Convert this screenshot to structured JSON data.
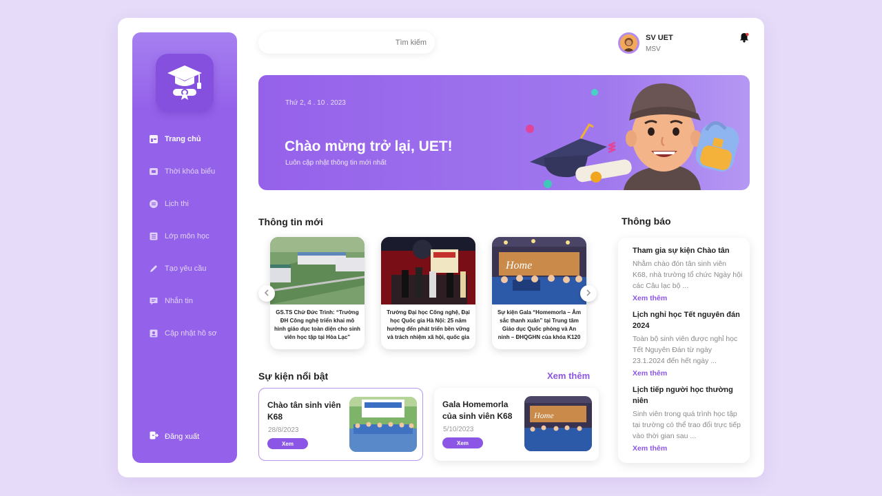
{
  "sidebar": {
    "logo_icon": "graduation-cap-icon",
    "items": [
      {
        "label": "Trang chủ",
        "icon": "home-icon",
        "active": true
      },
      {
        "label": "Thời khóa biểu",
        "icon": "schedule-icon"
      },
      {
        "label": "Lịch thi",
        "icon": "exam-icon"
      },
      {
        "label": "Lớp môn học",
        "icon": "class-icon"
      },
      {
        "label": "Tạo yêu cầu",
        "icon": "pen-icon"
      },
      {
        "label": "Nhắn tin",
        "icon": "chat-icon"
      },
      {
        "label": "Cập nhật hồ sơ",
        "icon": "profile-icon"
      }
    ],
    "logout_label": "Đăng xuất"
  },
  "header": {
    "search_placeholder": "Tìm kiếm",
    "user_name": "SV UET",
    "user_id": "MSV"
  },
  "banner": {
    "date": "Thứ 2, 4 . 10 . 2023",
    "title": "Chào mừng trở lại, UET!",
    "subtitle": "Luôn cập nhật thông tin mới nhất"
  },
  "news": {
    "title": "Thông tin mới",
    "items": [
      {
        "text": "GS.TS Chử Đức Trình: “Trường ĐH Công nghệ triển khai mô hình giáo dục toàn diện cho sinh viên học tập tại Hòa Lạc”"
      },
      {
        "text": "Trường Đại học Công nghệ, Đại học Quốc gia Hà Nội: 25 năm hướng đến phát triển bền vững và trách nhiệm xã hội, quốc gia"
      },
      {
        "text": "Sự kiện Gala “Homemorla – Âm sắc thanh xuân” tại Trung tâm Giáo dục Quốc phòng và An ninh – ĐHQGHN của khóa K120"
      }
    ]
  },
  "events": {
    "title": "Sự kiện nổi bật",
    "see_more": "Xem thêm",
    "items": [
      {
        "title": "Chào tân sinh viên K68",
        "date": "28/8/2023",
        "button": "Xem"
      },
      {
        "title": "Gala Homemorla của sinh viên K68",
        "date": "5/10/2023",
        "button": "Xem"
      }
    ]
  },
  "announcements": {
    "title": "Thông báo",
    "items": [
      {
        "title": "Tham gia sự kiện Chào tân",
        "desc": "Nhằm chào đón tân sinh viên K68, nhà trường tổ chức Ngày hội các Câu lạc bộ ...",
        "more": "Xem thêm"
      },
      {
        "title": "Lịch nghỉ học Tết nguyên đán 2024",
        "desc": "Toàn bộ sinh viên được nghỉ học Tết Nguyên Đán từ ngày 23.1.2024 đến hết ngày ...",
        "more": "Xem thêm"
      },
      {
        "title": "Lịch tiếp người học thường niên",
        "desc": "Sinh viên trong quá trình học tập tại trường có thể trao đổi trực tiếp vào thời gian sau ...",
        "more": "Xem thêm"
      }
    ]
  },
  "colors": {
    "accent": "#8b55e6",
    "sidebar": "#9461ea",
    "background": "#e6dbf8"
  }
}
